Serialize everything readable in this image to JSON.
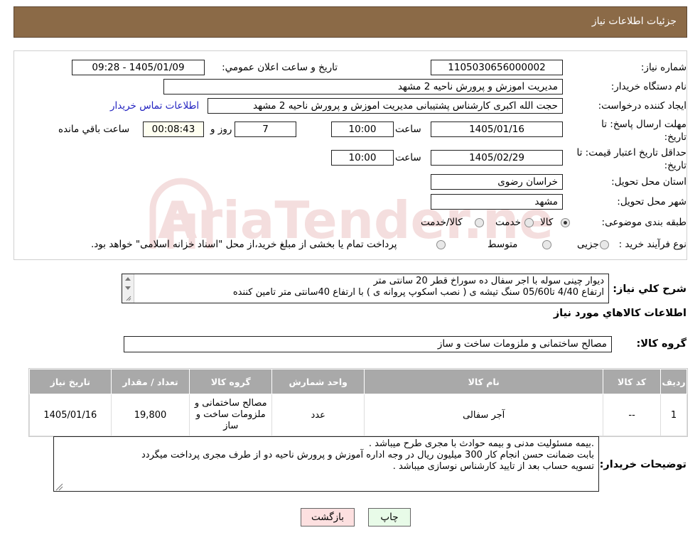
{
  "header": {
    "title": "جزئیات اطلاعات نیاز"
  },
  "need_number": {
    "label": "شماره نیاز:",
    "value": "1105030656000002"
  },
  "announce_date": {
    "label": "تاریخ و ساعت اعلان عمومي:",
    "value": "1405/01/09 - 09:28"
  },
  "buyer_org": {
    "label": "نام دستگاه خریدار:",
    "value": "مدیریت اموزش و پرورش ناحیه 2 مشهد"
  },
  "requester": {
    "label": "ایجاد کننده درخواست:",
    "value": "حجت الله اکبری کارشناس پشتیبانی مدیریت اموزش و پرورش ناحیه 2 مشهد",
    "contact_link": "اطلاعات تماس خریدار"
  },
  "reply_deadline": {
    "label": "مهلت ارسال پاسخ: تا تاریخ:",
    "date": "1405/01/16",
    "time_label": "ساعت",
    "time": "10:00",
    "days": "7",
    "days_label": "روز و",
    "remaining": "00:08:43",
    "remaining_label": "ساعت باقي مانده"
  },
  "price_validity": {
    "label": "حداقل تاریخ اعتبار قیمت: تا تاریخ:",
    "date": "1405/02/29",
    "time_label": "ساعت",
    "time": "10:00"
  },
  "province": {
    "label": "استان محل تحویل:",
    "value": "خراسان رضوی"
  },
  "city": {
    "label": "شهر محل تحویل:",
    "value": "مشهد"
  },
  "category": {
    "label": "طبقه بندی موضوعی:",
    "options": [
      "کالا",
      "خدمت",
      "کالا/خدمت"
    ],
    "selected": "کالا"
  },
  "purchase_type": {
    "label": "نوع فرآیند خرید :",
    "options": [
      "جزیی",
      "متوسط"
    ],
    "note": "پرداخت تمام یا بخشی از مبلغ خرید،از محل \"اسناد خزانه اسلامی\" خواهد بود."
  },
  "description": {
    "label": "شرح کلي نیاز:",
    "line1": "دیوار چینی سوله با اجر سفال ده سوراخ قطر  20 سانتی متر",
    "line2": "ارتفاع 4/40 تا05/60  سنگ تیشه ی ( نصب اسکوپ پروانه ی ) با ارتفاع 40سانتی متر تامین کننده"
  },
  "items_section": {
    "title": "اطلاعات کالاهاي مورد نیاز"
  },
  "goods_group": {
    "label": "گروه کالا:",
    "value": "مصالح ساختمانی و ملزومات ساخت و ساز"
  },
  "table": {
    "columns": [
      "ردیف",
      "کد کالا",
      "نام کالا",
      "واحد شمارش",
      "گروه کالا",
      "تعداد / مقدار",
      "تاریخ نیاز"
    ],
    "rows": [
      [
        "1",
        "--",
        "آجر سفالی",
        "عدد",
        "مصالح ساختمانی و ملزومات ساخت و ساز",
        "19,800",
        "1405/01/16"
      ]
    ]
  },
  "buyer_notes": {
    "label": "توضیحات خریدار:",
    "line1": ".بیمه مسئولیت مدنی و بیمه حوادث با مجری طرح میباشد .",
    "line2": "بابت ضمانت حسن انجام کار 300 میلیون ریال در وجه اداره آموزش و پرورش ناحیه دو از طرف مجری پرداخت میگردد",
    "line3": "تسویه حساب بعد از تایید کارشناس نوسازی میباشد ."
  },
  "buttons": {
    "print": "چاپ",
    "back": "بازگشت"
  },
  "watermark": {
    "text": "AriaTender.neT"
  },
  "colors": {
    "header_bg": "#8b6a47",
    "table_header_bg": "#a9a9a9",
    "back_button_bg": "#fde0e0",
    "print_button_bg": "#e8fbe8"
  }
}
